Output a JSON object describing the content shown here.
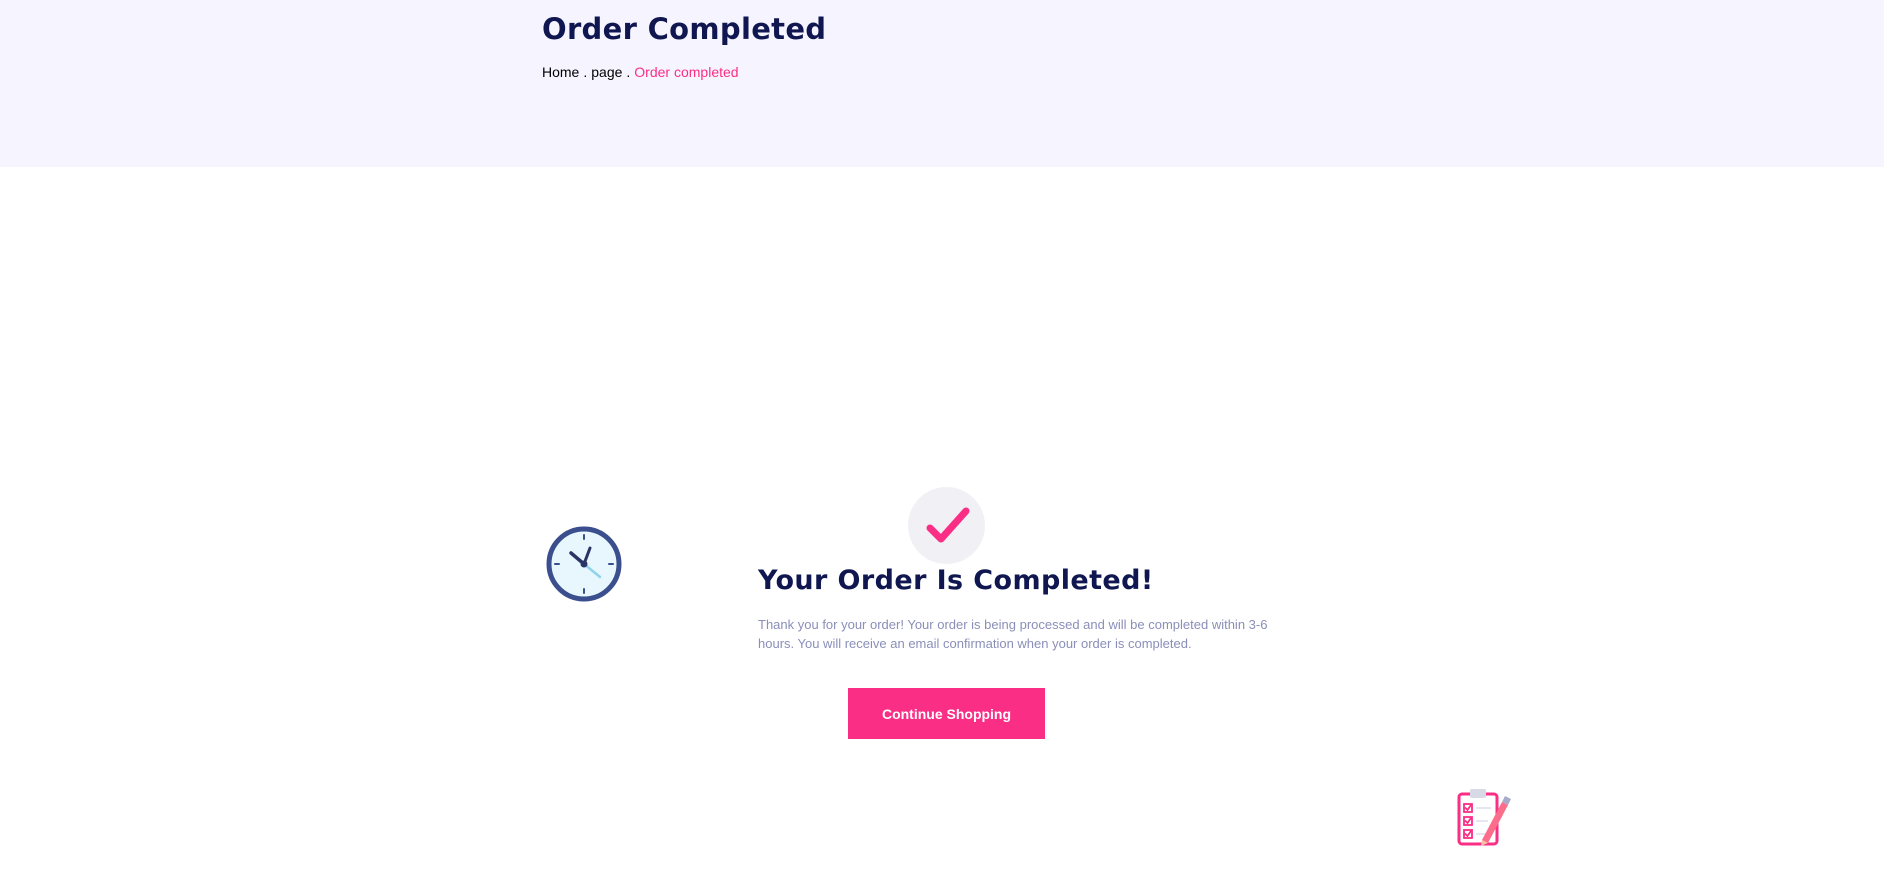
{
  "header": {
    "title": "Order Completed",
    "breadcrumb": {
      "home": "Home",
      "separator": ".",
      "page": "page",
      "current": "Order completed"
    }
  },
  "main": {
    "heading": "Your Order Is Completed!",
    "message": "Thank you for your order! Your order is being processed and will be completed within 3-6 hours. You will receive an email confirmation when your order is completed.",
    "button_label": "Continue Shopping"
  },
  "icons": {
    "check": "check-icon",
    "clock": "clock-icon",
    "clipboard": "clipboard-checklist-icon"
  },
  "colors": {
    "accent": "#fb2e86",
    "heading": "#101750",
    "text_muted": "#8a8fb9",
    "hero_background": "#f6f5ff"
  }
}
